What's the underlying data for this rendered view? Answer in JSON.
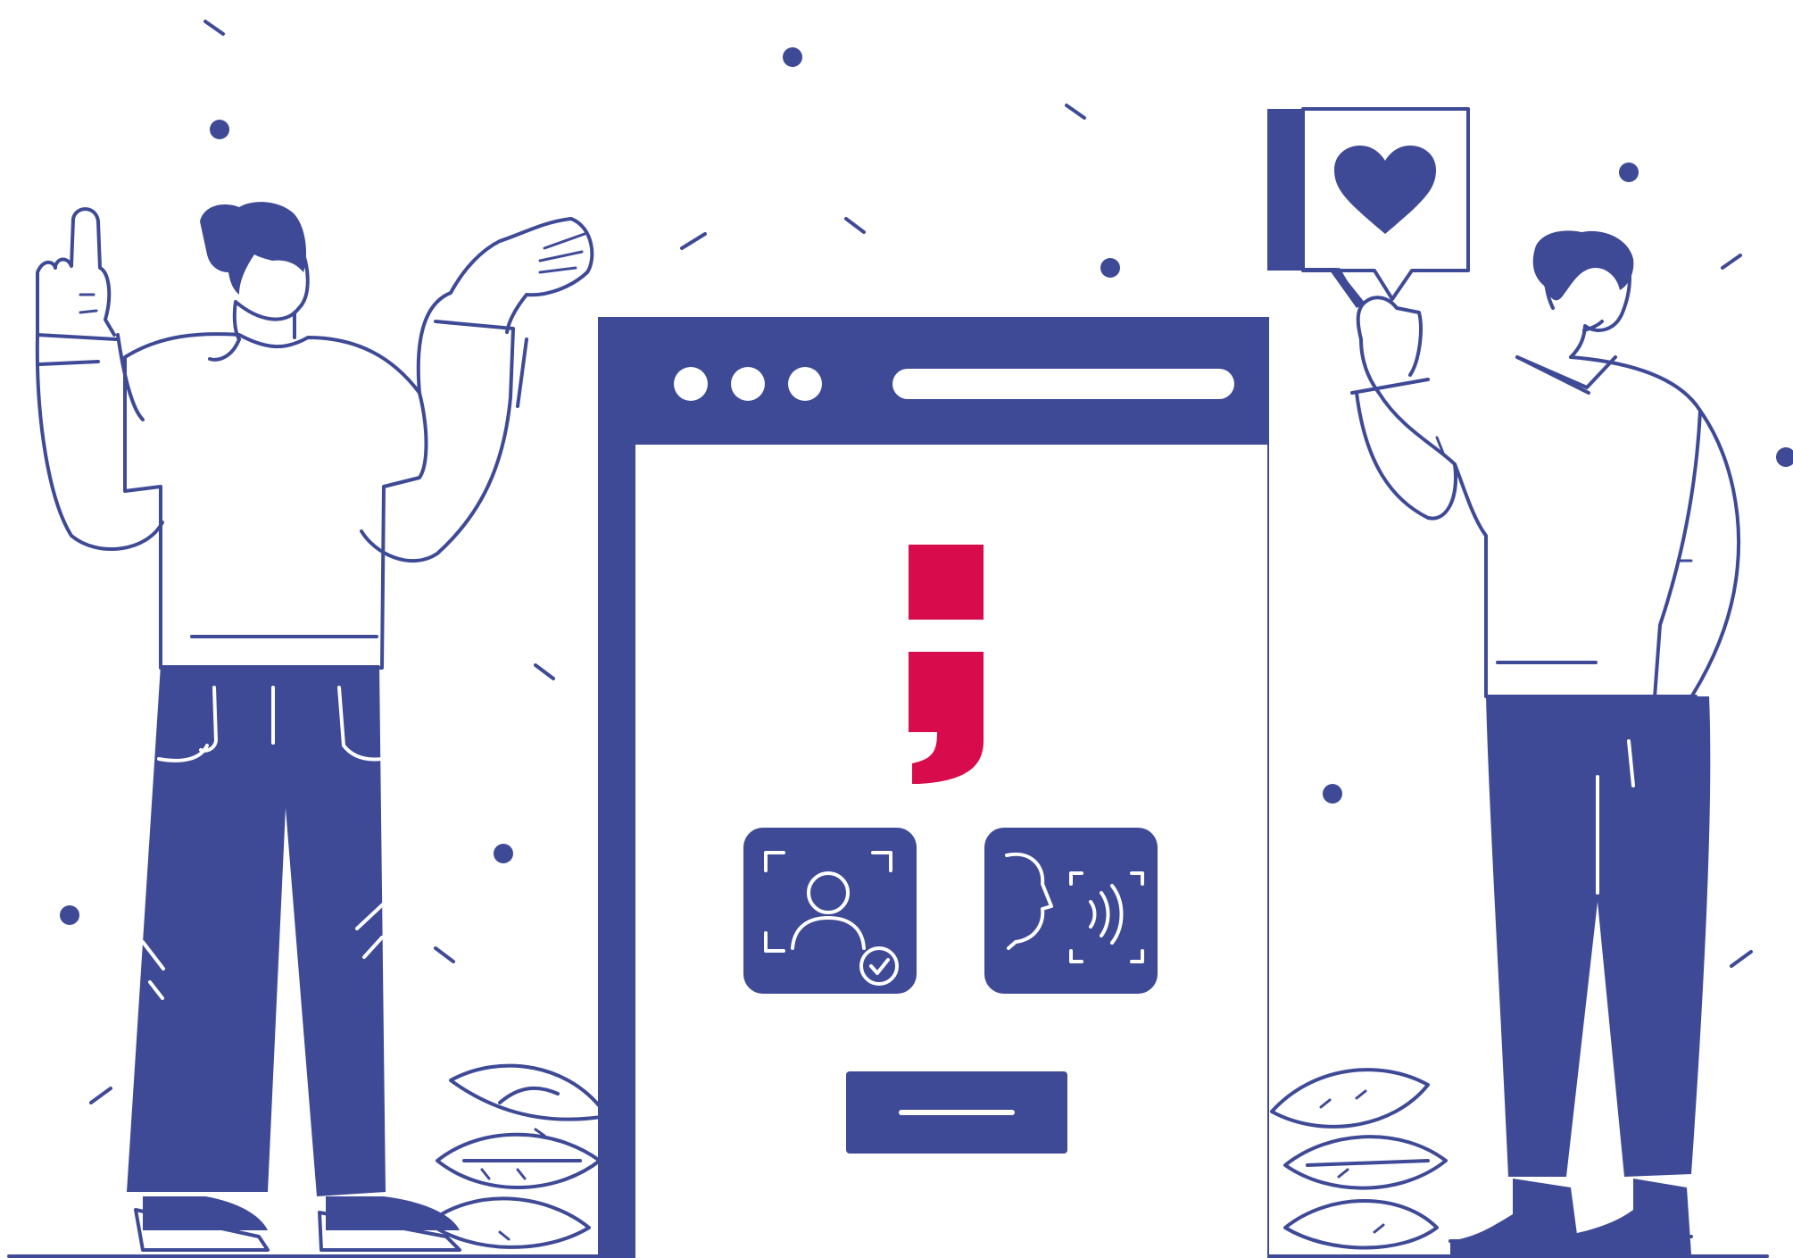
{
  "illustration": {
    "colors": {
      "primary": "#3e4a96",
      "accent": "#d80b4c",
      "background": "#ffffff"
    },
    "browser_window": {
      "window_controls": [
        "dot",
        "dot",
        "dot"
      ],
      "brand_mark": "semicolon-logo",
      "feature_tiles": [
        {
          "icon": "face-recognition-verified-icon"
        },
        {
          "icon": "voice-recognition-icon"
        }
      ],
      "primary_action": "blank-button"
    },
    "figures": [
      {
        "pose": "gesturing-thumbs-up",
        "side": "left"
      },
      {
        "pose": "holding-heart-sign",
        "side": "right"
      }
    ],
    "sign_icon": "heart-icon"
  }
}
